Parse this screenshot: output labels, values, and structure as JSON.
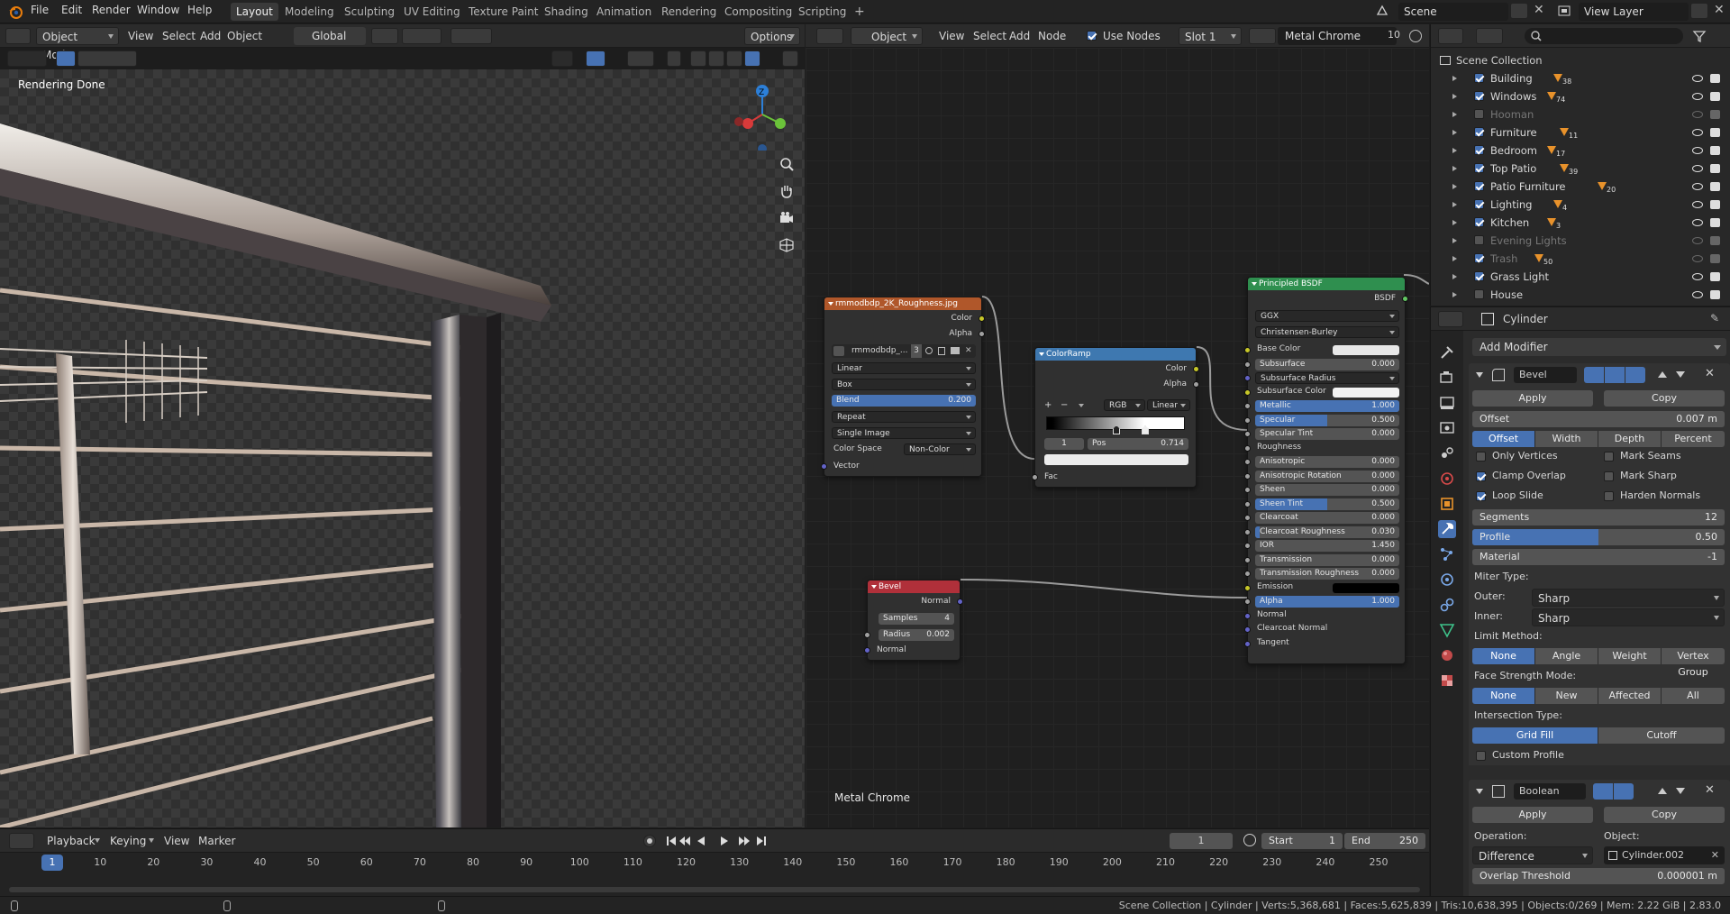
{
  "topbar": {
    "menus": [
      "File",
      "Edit",
      "Render",
      "Window",
      "Help"
    ],
    "workspaces": [
      {
        "label": "Layout",
        "active": true
      },
      {
        "label": "Modeling",
        "active": false
      },
      {
        "label": "Sculpting",
        "active": false
      },
      {
        "label": "UV Editing",
        "active": false
      },
      {
        "label": "Texture Paint",
        "active": false
      },
      {
        "label": "Shading",
        "active": false
      },
      {
        "label": "Animation",
        "active": false
      },
      {
        "label": "Rendering",
        "active": false
      },
      {
        "label": "Compositing",
        "active": false
      },
      {
        "label": "Scripting",
        "active": false
      }
    ],
    "add_workspace": "+",
    "scene_name": "Scene",
    "view_layer": "View Layer"
  },
  "viewport": {
    "mode": "Object Mode",
    "menus": [
      "View",
      "Select",
      "Add",
      "Object"
    ],
    "orientation": "Global",
    "options_label": "Options",
    "status_text": "Rendering Done",
    "gizmo_z": "Z"
  },
  "node_editor": {
    "editor_type": "Object",
    "menus": [
      "View",
      "Select",
      "Add",
      "Node"
    ],
    "use_nodes_label": "Use Nodes",
    "use_nodes": true,
    "slot": "Slot 1",
    "material_name": "Metal Chrome",
    "user_count": "10",
    "material_label": "Metal Chrome",
    "image_node": {
      "title": "rmmodbdp_2K_Roughness.jpg",
      "out_color": "Color",
      "out_alpha": "Alpha",
      "image_name": "rmmodbdp_...",
      "image_users": "3",
      "interpolation": "Linear",
      "projection": "Box",
      "blend_label": "Blend",
      "blend_value": "0.200",
      "extension": "Repeat",
      "source": "Single Image",
      "color_space_label": "Color Space",
      "color_space": "Non-Color",
      "in_vector": "Vector"
    },
    "colorramp_node": {
      "title": "ColorRamp",
      "out_color": "Color",
      "out_alpha": "Alpha",
      "plus": "+",
      "minus": "−",
      "mode": "RGB",
      "interp": "Linear",
      "index": "1",
      "pos_label": "Pos",
      "pos_value": "0.714",
      "in_fac": "Fac"
    },
    "bevel_node": {
      "title": "Bevel",
      "out_normal": "Normal",
      "samples_label": "Samples",
      "samples_value": "4",
      "radius_label": "Radius",
      "radius_value": "0.002",
      "in_normal": "Normal"
    },
    "bsdf_node": {
      "title": "Principled BSDF",
      "out_bsdf": "BSDF",
      "distribution": "GGX",
      "subsurface_method": "Christensen-Burley",
      "rows": [
        {
          "label": "Base Color",
          "type": "color",
          "color": "#e8e8e8"
        },
        {
          "label": "Subsurface",
          "value": "0.000"
        },
        {
          "label": "Subsurface Radius",
          "type": "select"
        },
        {
          "label": "Subsurface Color",
          "type": "color",
          "color": "#f2f2f2"
        },
        {
          "label": "Metallic",
          "value": "1.000",
          "fill": 1.0
        },
        {
          "label": "Specular",
          "value": "0.500",
          "fill": 0.5
        },
        {
          "label": "Specular Tint",
          "value": "0.000"
        },
        {
          "label": "Roughness",
          "type": "socket"
        },
        {
          "label": "Anisotropic",
          "value": "0.000"
        },
        {
          "label": "Anisotropic Rotation",
          "value": "0.000"
        },
        {
          "label": "Sheen",
          "value": "0.000"
        },
        {
          "label": "Sheen Tint",
          "value": "0.500",
          "fill": 0.5
        },
        {
          "label": "Clearcoat",
          "value": "0.000"
        },
        {
          "label": "Clearcoat Roughness",
          "value": "0.030",
          "fill": 0.03
        },
        {
          "label": "IOR",
          "value": "1.450"
        },
        {
          "label": "Transmission",
          "value": "0.000"
        },
        {
          "label": "Transmission Roughness",
          "value": "0.000"
        },
        {
          "label": "Emission",
          "type": "color",
          "color": "#000000"
        },
        {
          "label": "Alpha",
          "value": "1.000",
          "fill": 1.0
        },
        {
          "label": "Normal",
          "type": "socket"
        },
        {
          "label": "Clearcoat Normal",
          "type": "socket"
        },
        {
          "label": "Tangent",
          "type": "socket"
        }
      ]
    }
  },
  "outliner": {
    "root": "Scene Collection",
    "items": [
      {
        "name": "Building",
        "checked": true,
        "dim": false,
        "badge": "38"
      },
      {
        "name": "Windows",
        "checked": true,
        "dim": false,
        "badge": "74"
      },
      {
        "name": "Hooman",
        "checked": false,
        "dim": true,
        "badge": ""
      },
      {
        "name": "Furniture",
        "checked": true,
        "dim": false,
        "badge": "11"
      },
      {
        "name": "Bedroom",
        "checked": true,
        "dim": false,
        "badge": "17"
      },
      {
        "name": "Top Patio",
        "checked": true,
        "dim": false,
        "badge": "39"
      },
      {
        "name": "Patio Furniture",
        "checked": true,
        "dim": false,
        "badge": "20"
      },
      {
        "name": "Lighting",
        "checked": true,
        "dim": false,
        "badge": "4"
      },
      {
        "name": "Kitchen",
        "checked": true,
        "dim": false,
        "badge": "3"
      },
      {
        "name": "Evening Lights",
        "checked": false,
        "dim": true,
        "badge": ""
      },
      {
        "name": "Trash",
        "checked": true,
        "dim": true,
        "badge": "50"
      },
      {
        "name": "Grass Light",
        "checked": true,
        "dim": false,
        "badge": ""
      },
      {
        "name": "House",
        "checked": false,
        "dim": false,
        "badge": ""
      }
    ]
  },
  "properties": {
    "object_name": "Cylinder",
    "add_modifier": "Add Modifier",
    "bevel": {
      "name": "Bevel",
      "apply": "Apply",
      "copy": "Copy",
      "offset_label": "Offset",
      "offset_value": "0.007 m",
      "width_types": [
        "Offset",
        "Width",
        "Depth",
        "Percent"
      ],
      "width_type_active": 0,
      "only_vertices": "Only Vertices",
      "mark_seams": "Mark Seams",
      "clamp_overlap": "Clamp Overlap",
      "mark_sharp": "Mark Sharp",
      "loop_slide": "Loop Slide",
      "harden_normals": "Harden Normals",
      "segments_label": "Segments",
      "segments_value": "12",
      "profile_label": "Profile",
      "profile_value": "0.50",
      "profile_fill": 0.5,
      "material_label": "Material",
      "material_value": "-1",
      "miter_type": "Miter Type:",
      "outer_label": "Outer:",
      "outer_value": "Sharp",
      "inner_label": "Inner:",
      "inner_value": "Sharp",
      "limit_method": "Limit Method:",
      "limit_options": [
        "None",
        "Angle",
        "Weight",
        "Vertex Group"
      ],
      "face_strength": "Face Strength Mode:",
      "face_options": [
        "None",
        "New",
        "Affected",
        "All"
      ],
      "intersection": "Intersection Type:",
      "intersection_options": [
        "Grid Fill",
        "Cutoff"
      ],
      "custom_profile": "Custom Profile"
    },
    "boolean": {
      "name": "Boolean",
      "apply": "Apply",
      "copy": "Copy",
      "operation_label": "Operation:",
      "operation_value": "Difference",
      "object_label": "Object:",
      "object_value": "Cylinder.002",
      "overlap_label": "Overlap Threshold",
      "overlap_value": "0.000001 m"
    }
  },
  "timeline": {
    "menus": [
      "Playback",
      "Keying",
      "View",
      "Marker"
    ],
    "current_frame": "1",
    "start_label": "Start",
    "start_value": "1",
    "end_label": "End",
    "end_value": "250",
    "ticks": [
      "1",
      "10",
      "20",
      "30",
      "40",
      "50",
      "60",
      "70",
      "80",
      "90",
      "100",
      "110",
      "120",
      "130",
      "140",
      "150",
      "160",
      "170",
      "180",
      "190",
      "200",
      "210",
      "220",
      "230",
      "240",
      "250"
    ]
  },
  "statusbar": {
    "text": "Scene Collection | Cylinder | Verts:5,368,681 | Faces:5,625,839 | Tris:10,638,395 | Objects:0/269 | Mem: 2.22 GiB | 2.83.0"
  },
  "colors": {
    "accent": "#4772b3",
    "image_header": "#b0572a",
    "colorramp_header": "#3e78b0",
    "bevel_header": "#b0303a",
    "bsdf_header": "#2f8f4f",
    "socket_yellow": "#c7c729",
    "socket_purple": "#6363c7",
    "socket_gray": "#a1a1a1",
    "socket_green": "#63c763"
  }
}
